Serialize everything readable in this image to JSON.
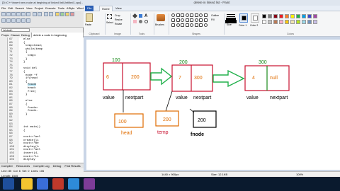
{
  "ide": {
    "title": "[D:\\C++\\insert new node at begining of linked list\\Untitled1.cpp] - Dev-C++ 5.11",
    "menu": [
      "File",
      "Edit",
      "Search",
      "View",
      "Project",
      "Execute",
      "Tools",
      "AStyle",
      "Window",
      "Help"
    ],
    "combo_value": "(globals)",
    "tabs": [
      "Project",
      "Classes",
      "Debug"
    ],
    "file_tab": "delete a node in beginning",
    "line_numbers": [
      "67",
      "68",
      "69",
      "70",
      "71",
      "72",
      "73",
      "74",
      "75",
      "76",
      "77",
      "78",
      "79",
      "80",
      "81",
      "82",
      "83",
      "84",
      "85",
      "86",
      "87",
      "88",
      "89",
      "90",
      "91",
      "92",
      "93",
      "94",
      "95",
      "96",
      "97",
      "98",
      "99",
      "100",
      "101",
      "102",
      "103",
      "104"
    ],
    "code_lines": [
      "else",
      "{",
      "temp=head;",
      "while(temp",
      "{",
      "temp=",
      "}",
      "}",
      "",
      "void del",
      "{",
      "node *f",
      "if(head",
      "{",
      "fnode",
      "head=",
      "free(",
      "}",
      "",
      "else",
      "{",
      "fnode=",
      "fnode-",
      "}",
      "",
      "",
      "",
      "int main()",
      "{",
      "",
      "  cout<<\"wel",
      "  create(li",
      "  cout<<\"Be",
      "  display(h",
      "  cout<<\"wel",
      "  insert(4,",
      "  cout<<\"Li",
      "  display"
    ],
    "bottom_tabs": [
      "Compiler",
      "Resources",
      "Compile Log",
      "Debug",
      "Find Results"
    ],
    "status": {
      "line_label": "Line:",
      "line_value": "85",
      "col_label": "Col:",
      "col_value": "6",
      "sel_label": "Sel:",
      "sel_value": "0",
      "lines_label": "Lines:",
      "lines_value": "106",
      "length_label": "Length:",
      "length_value": "1545"
    }
  },
  "paint": {
    "title": "delete in linked list - Paint",
    "tabs": {
      "file": "File",
      "home": "Home",
      "view": "View"
    },
    "ribbon": {
      "paste": "Paste",
      "clipboard": "Clipboard",
      "image": "Image",
      "tools": "Tools",
      "brushes": "Brushes",
      "shapes": "Shapes",
      "size": "Size",
      "color1": "Color 1",
      "color2": "Color 2",
      "colors": "Colors",
      "crop": "Crop",
      "resize": "Resize",
      "rotate": "Rotate",
      "select": "Select",
      "outline": "Outline",
      "fill": "Fill"
    },
    "palette_colors": [
      "#000000",
      "#7f7f7f",
      "#880015",
      "#ed1c24",
      "#ff7f27",
      "#fff200",
      "#22b14c",
      "#00a2e8",
      "#3f48cc",
      "#a349a4",
      "#ffffff",
      "#c3c3c3",
      "#b97a57",
      "#ffaec9",
      "#ffc90e",
      "#efe4b0",
      "#b5e61d",
      "#99d9ea",
      "#7092be",
      "#c8bfe7"
    ],
    "color1": "#000000",
    "color2": "#ffffff",
    "status": {
      "size": "1440 × 900px",
      "file_size": "Size: 12.1KB",
      "zoom": "100%"
    }
  },
  "diagram": {
    "nodes": [
      {
        "address": "100",
        "value": "6",
        "next": "200",
        "value_label": "value",
        "next_label": "nextpart"
      },
      {
        "address": "200",
        "value": "7",
        "next": "300",
        "value_label": "value",
        "next_label": "nextpart"
      },
      {
        "address": "300",
        "value": "4",
        "next": "null",
        "value_label": "value",
        "next_label": "nextpart"
      }
    ],
    "pointers": [
      {
        "value": "100",
        "label": "head"
      },
      {
        "value": "200",
        "label": "temp"
      },
      {
        "value": "200",
        "label": "fnode"
      }
    ],
    "colors": {
      "address": "#1a8a1a",
      "node_box": "#c8102e",
      "divider": "#c8102e",
      "node_text": "#e06c00",
      "value_text": "#000000",
      "arrow": "#22b14c",
      "pointer_box": "#e06c00",
      "head_label": "#e06c00",
      "temp_label": "#c8102e",
      "fnode_label": "#000000"
    }
  }
}
